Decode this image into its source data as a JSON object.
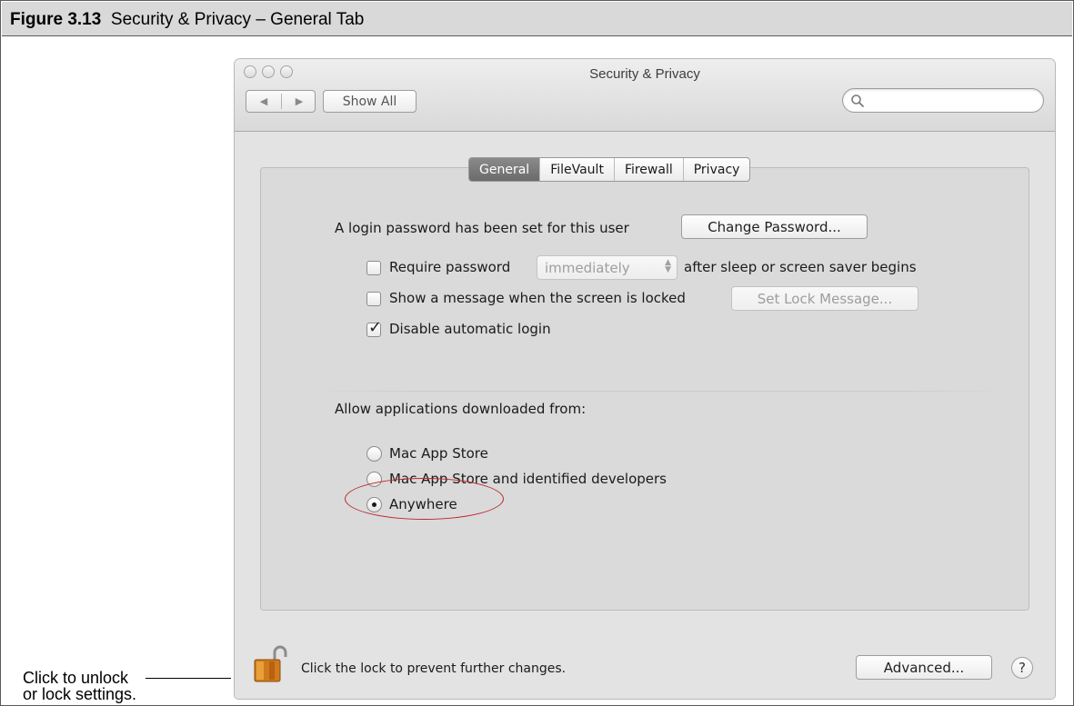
{
  "caption": {
    "label": "Figure 3.13",
    "title": "Security & Privacy – General Tab"
  },
  "window": {
    "title": "Security & Privacy",
    "show_all_label": "Show All",
    "search": {
      "placeholder": "",
      "value": ""
    }
  },
  "tabs": [
    {
      "label": "General",
      "selected": true
    },
    {
      "label": "FileVault",
      "selected": false
    },
    {
      "label": "Firewall",
      "selected": false
    },
    {
      "label": "Privacy",
      "selected": false
    }
  ],
  "general": {
    "login_password_text": "A login password has been set for this user",
    "change_password_label": "Change Password...",
    "require_password": {
      "label": "Require password",
      "checked": false,
      "delay_value": "immediately",
      "suffix": "after sleep or screen saver begins"
    },
    "show_message": {
      "label": "Show a message when the screen is locked",
      "checked": false,
      "button_label": "Set Lock Message..."
    },
    "disable_auto_login": {
      "label": "Disable automatic login",
      "checked": true
    }
  },
  "allow_apps": {
    "heading": "Allow applications downloaded from:",
    "options": [
      {
        "label": "Mac App Store",
        "selected": false
      },
      {
        "label": "Mac App Store and identified developers",
        "selected": false
      },
      {
        "label": "Anywhere",
        "selected": true
      }
    ],
    "highlight_color": "#c0242a"
  },
  "footer": {
    "lock_text": "Click the lock to prevent further changes.",
    "advanced_label": "Advanced...",
    "help_label": "?"
  },
  "callout": {
    "line1": "Click to unlock",
    "line2": "or lock settings."
  }
}
